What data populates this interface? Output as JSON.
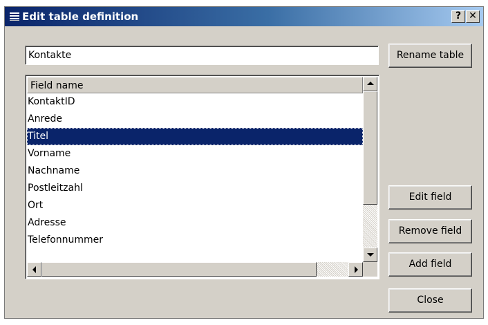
{
  "window": {
    "title": "Edit table definition",
    "help_label": "?",
    "close_label": "✕"
  },
  "table_name": {
    "value": "Kontakte"
  },
  "buttons": {
    "rename": "Rename table",
    "edit_field": "Edit field",
    "remove_field": "Remove field",
    "add_field": "Add field",
    "close": "Close"
  },
  "fields_list": {
    "header": "Field name",
    "selected_index": 2,
    "items": [
      "KontaktID",
      "Anrede",
      "Titel",
      "Vorname",
      "Nachname",
      "Postleitzahl",
      "Ort",
      "Adresse",
      "Telefonnummer"
    ]
  },
  "colors": {
    "title_bar": "#0a246a",
    "selection": "#0a246a",
    "dialog_bg": "#d4d0c8"
  }
}
